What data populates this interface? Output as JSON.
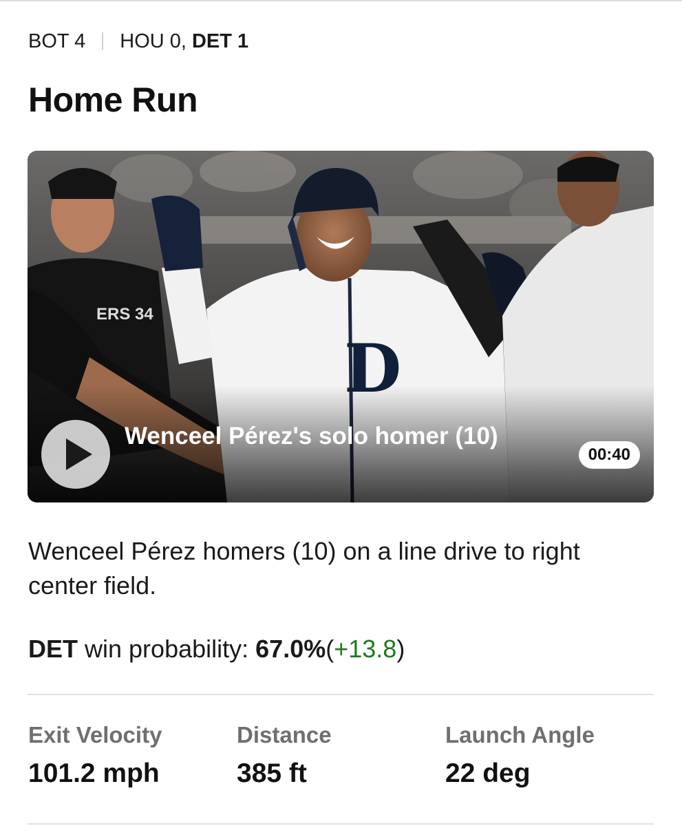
{
  "game_status": {
    "inning": "BOT 4",
    "away": "HOU 0,",
    "home": "DET 1"
  },
  "play": {
    "title": "Home Run",
    "description": "Wenceel Pérez homers (10) on a line drive to right center field."
  },
  "video": {
    "title": "Wenceel Pérez's solo homer (10)",
    "duration": "00:40"
  },
  "win_probability": {
    "team": "DET",
    "label": "win probability:",
    "value": "67.0%",
    "open_paren": "(",
    "delta": "+13.8",
    "close_paren": ")",
    "delta_color": "#1d7a1d"
  },
  "statcast": [
    {
      "label": "Exit Velocity",
      "value": "101.2 mph"
    },
    {
      "label": "Distance",
      "value": "385 ft"
    },
    {
      "label": "Launch Angle",
      "value": "22 deg"
    }
  ]
}
